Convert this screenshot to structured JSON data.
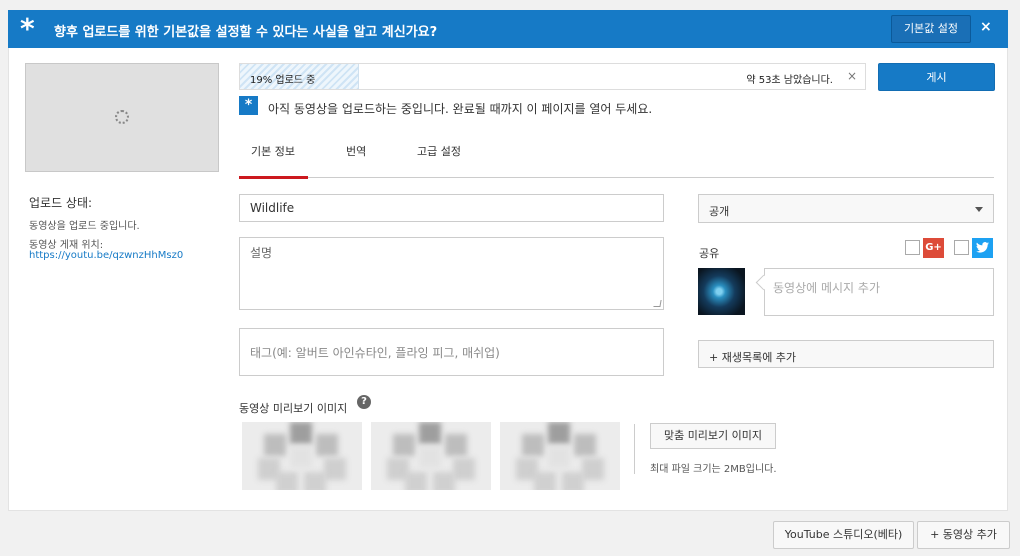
{
  "banner": {
    "icon": "asterisk-icon",
    "message": "향후 업로드를 위한 기본값을 설정할 수 있다는 사실을 알고 계신가요?",
    "defaults_button": "기본값 설정",
    "close": "×"
  },
  "left": {
    "status_title": "업로드 상태:",
    "status_text": "동영상을 업로드 중입니다.",
    "location_label": "동영상 게재 위치:",
    "location_url": "https://youtu.be/qzwnzHhMsz0"
  },
  "upload": {
    "progress_label": "19% 업로드 중",
    "progress_fraction": 0.19,
    "remaining": "약 53초 남았습니다.",
    "cancel": "×",
    "publish": "게시",
    "notice_icon": "star-icon",
    "notice": "아직 동영상을 업로드하는 중입니다. 완료될 때까지 이 페이지를 열어 두세요."
  },
  "tabs": [
    {
      "label": "기본 정보",
      "active": true
    },
    {
      "label": "번역",
      "active": false
    },
    {
      "label": "고급 설정",
      "active": false
    }
  ],
  "form": {
    "title_value": "Wildlife",
    "description_placeholder": "설명",
    "tags_placeholder": "태그(예: 알버트 아인슈타인, 플라잉 피그, 매쉬업)"
  },
  "side": {
    "privacy_value": "공개",
    "share_label": "공유",
    "gplus_text": "G+",
    "twitter_text": "🐦",
    "message_placeholder": "동영상에 메시지 추가",
    "playlist_button": "+ 재생목록에 추가"
  },
  "thumbnails": {
    "label": "동영상 미리보기 이미지",
    "help": "?",
    "custom_button": "맞춤 미리보기 이미지",
    "max_size": "최대 파일 크기는 2MB입니다."
  },
  "footer": {
    "studio_button": "YouTube 스튜디오(베타)",
    "add_video_button": "+ 동영상 추가"
  },
  "colors": {
    "accent": "#167ac6",
    "active_tab": "#cc181e"
  }
}
